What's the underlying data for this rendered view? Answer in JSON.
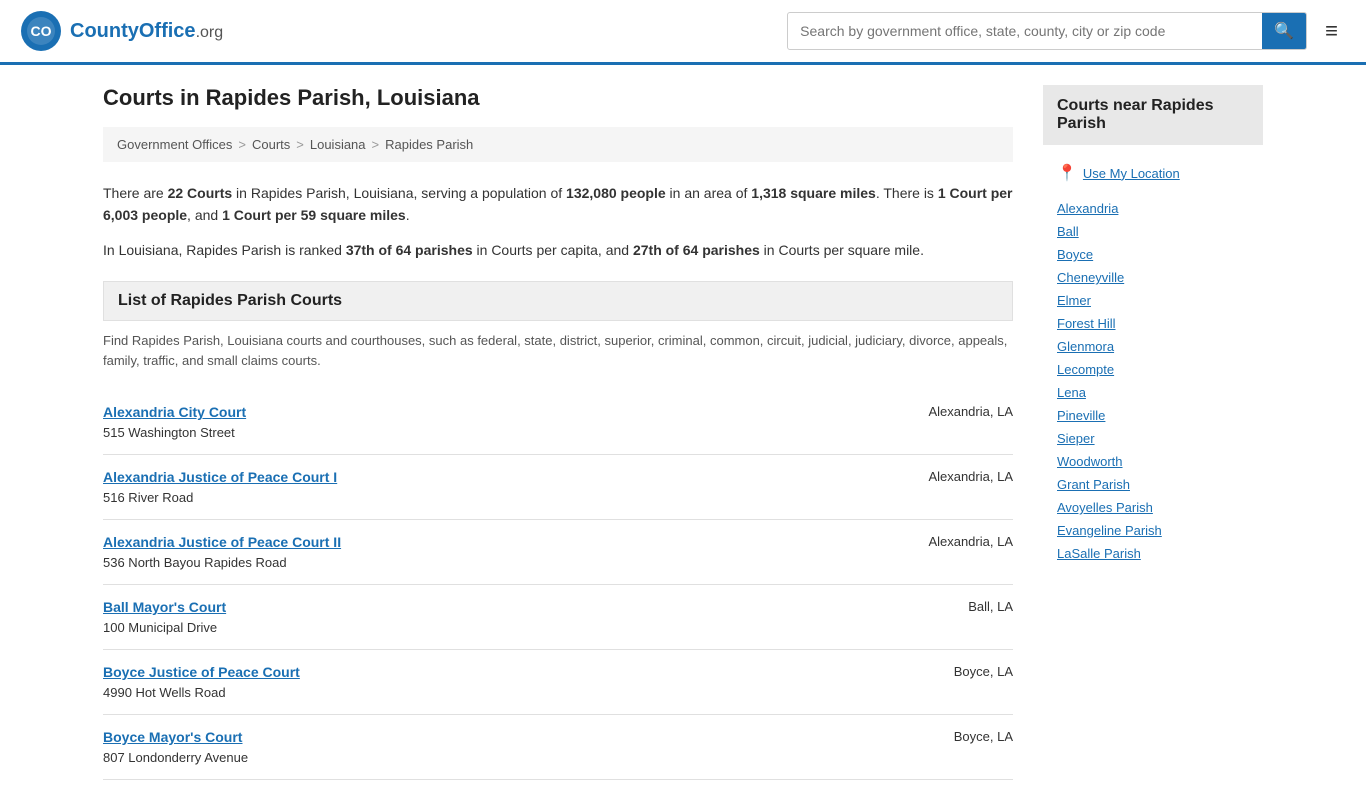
{
  "header": {
    "logo_text": "CountyOffice",
    "logo_suffix": ".org",
    "search_placeholder": "Search by government office, state, county, city or zip code",
    "menu_icon": "≡"
  },
  "page": {
    "title": "Courts in Rapides Parish, Louisiana"
  },
  "breadcrumb": {
    "items": [
      "Government Offices",
      "Courts",
      "Louisiana",
      "Rapides Parish"
    ]
  },
  "info": {
    "line1_pre": "There are ",
    "courts_count": "22 Courts",
    "line1_mid": " in Rapides Parish, Louisiana, serving a population of ",
    "population": "132,080 people",
    "line1_mid2": " in an area of ",
    "area": "1,318 square miles",
    "line1_post": ". There is ",
    "per_people": "1 Court per 6,003 people",
    "line1_and": ", and ",
    "per_sqmile": "1 Court per 59 square miles",
    "line1_end": ".",
    "line2_pre": "In Louisiana, Rapides Parish is ranked ",
    "rank_capita": "37th of 64 parishes",
    "line2_mid": " in Courts per capita, and ",
    "rank_sqmile": "27th of 64 parishes",
    "line2_post": " in Courts per square mile."
  },
  "list_section": {
    "heading": "List of Rapides Parish Courts",
    "description": "Find Rapides Parish, Louisiana courts and courthouses, such as federal, state, district, superior, criminal, common, circuit, judicial, judiciary, divorce, appeals, family, traffic, and small claims courts."
  },
  "courts": [
    {
      "name": "Alexandria City Court",
      "address": "515 Washington Street",
      "city": "Alexandria, LA"
    },
    {
      "name": "Alexandria Justice of Peace Court I",
      "address": "516 River Road",
      "city": "Alexandria, LA"
    },
    {
      "name": "Alexandria Justice of Peace Court II",
      "address": "536 North Bayou Rapides Road",
      "city": "Alexandria, LA"
    },
    {
      "name": "Ball Mayor's Court",
      "address": "100 Municipal Drive",
      "city": "Ball, LA"
    },
    {
      "name": "Boyce Justice of Peace Court",
      "address": "4990 Hot Wells Road",
      "city": "Boyce, LA"
    },
    {
      "name": "Boyce Mayor's Court",
      "address": "807 Londonderry Avenue",
      "city": "Boyce, LA"
    }
  ],
  "sidebar": {
    "title": "Courts near Rapides Parish",
    "use_location": "Use My Location",
    "cities": [
      "Alexandria",
      "Ball",
      "Boyce",
      "Cheneyville",
      "Elmer",
      "Forest Hill",
      "Glenmora",
      "Lecompte",
      "Lena",
      "Pineville",
      "Sieper",
      "Woodworth"
    ],
    "parishes": [
      "Grant Parish",
      "Avoyelles Parish",
      "Evangeline Parish",
      "LaSalle Parish"
    ]
  }
}
